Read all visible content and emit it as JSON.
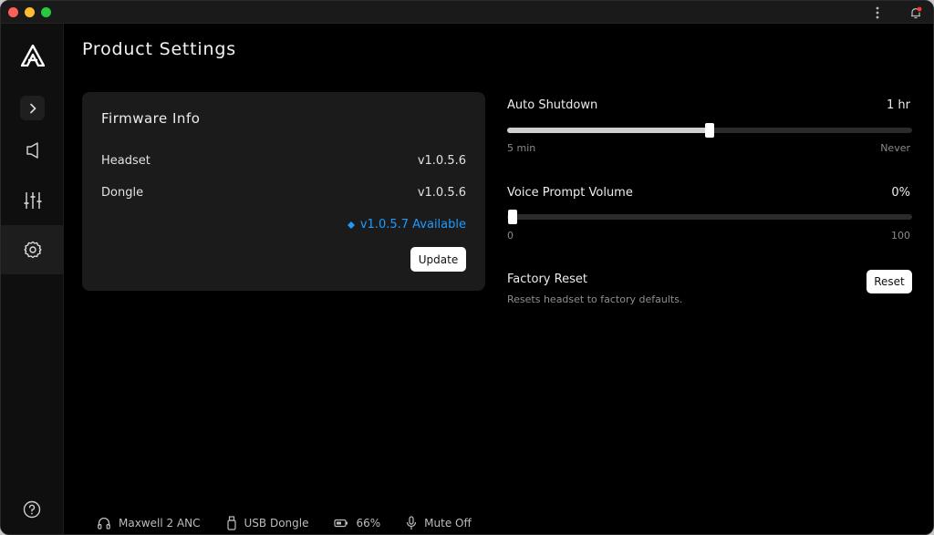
{
  "page": {
    "title": "Product Settings"
  },
  "sidebar": {
    "items": [
      "logo",
      "expand",
      "sound",
      "equalizer",
      "settings"
    ]
  },
  "firmware": {
    "title": "Firmware Info",
    "rows": [
      {
        "label": "Headset",
        "value": "v1.0.5.6"
      },
      {
        "label": "Dongle",
        "value": "v1.0.5.6"
      }
    ],
    "available": "v1.0.5.7 Available",
    "update_label": "Update"
  },
  "auto_shutdown": {
    "label": "Auto Shutdown",
    "value": "1 hr",
    "min_label": "5 min",
    "max_label": "Never",
    "level": 0.5
  },
  "voice_prompt": {
    "label": "Voice Prompt Volume",
    "value": "0%",
    "min_label": "0",
    "max_label": "100",
    "level": 0
  },
  "factory_reset": {
    "label": "Factory Reset",
    "description": "Resets headset to factory defaults.",
    "button_label": "Reset"
  },
  "status": {
    "device": "Maxwell 2 ANC",
    "connection": "USB Dongle",
    "battery": "66%",
    "mic": "Mute Off"
  },
  "colors": {
    "accent": "#1e9bff",
    "notification": "#ff3b30"
  }
}
